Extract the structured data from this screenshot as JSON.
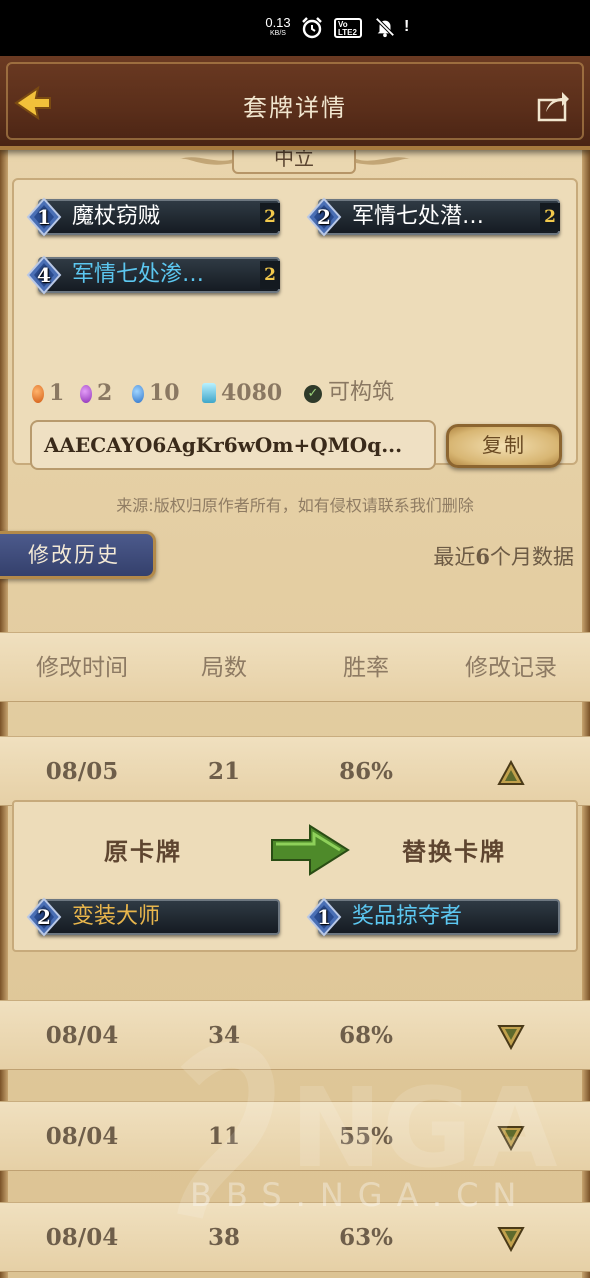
{
  "status_bar": {
    "net_speed": "0.13",
    "net_unit": "KB/S",
    "volte_top": "Vo",
    "volte_bottom": "LTE2",
    "extra": "!"
  },
  "header": {
    "title": "套牌详情"
  },
  "deck": {
    "faction": "中立",
    "cards": [
      {
        "cost": "1",
        "name": "魔杖窃贼",
        "count": "2",
        "color": "white"
      },
      {
        "cost": "2",
        "name": "军情七处潜…",
        "count": "2",
        "color": "white"
      },
      {
        "cost": "4",
        "name": "军情七处渗…",
        "count": "2",
        "color": "blue"
      }
    ],
    "rarity_counts": {
      "legendary": "1",
      "epic": "2",
      "rare": "10",
      "dust": "4080"
    },
    "buildable_label": "可构筑",
    "code": "AAECAYO6AgKr6wOm+QMOq...",
    "copy_label": "复制"
  },
  "source_note": "来源:版权归原作者所有，如有侵权请联系我们删除",
  "history": {
    "tab_label": "修改历史",
    "recent_prefix": "最近",
    "recent_num": "6",
    "recent_suffix": "个月数据",
    "columns": [
      "修改时间",
      "局数",
      "胜率",
      "修改记录"
    ],
    "rows": [
      {
        "date": "08/05",
        "games": "21",
        "winrate": "86%",
        "trend": "up"
      },
      {
        "date": "08/04",
        "games": "34",
        "winrate": "68%",
        "trend": "down"
      },
      {
        "date": "08/04",
        "games": "11",
        "winrate": "55%",
        "trend": "down"
      },
      {
        "date": "08/04",
        "games": "38",
        "winrate": "63%",
        "trend": "down"
      }
    ],
    "change": {
      "original_label": "原卡牌",
      "replacement_label": "替换卡牌",
      "original_card": {
        "cost": "2",
        "name": "变装大师",
        "color": "gold"
      },
      "replacement_card": {
        "cost": "1",
        "name": "奖品掠夺者",
        "color": "blue"
      }
    }
  },
  "watermark": {
    "logo_text": "NGA",
    "site": "BBS.NGA.CN"
  },
  "colors": {
    "header_bg": "#5a2e1a",
    "parchment": "#ead6ae",
    "card_bar": "#1f2730",
    "blue_text": "#5cc7f0",
    "gold_text": "#e9b64c",
    "count_gold": "#f2c94c"
  }
}
